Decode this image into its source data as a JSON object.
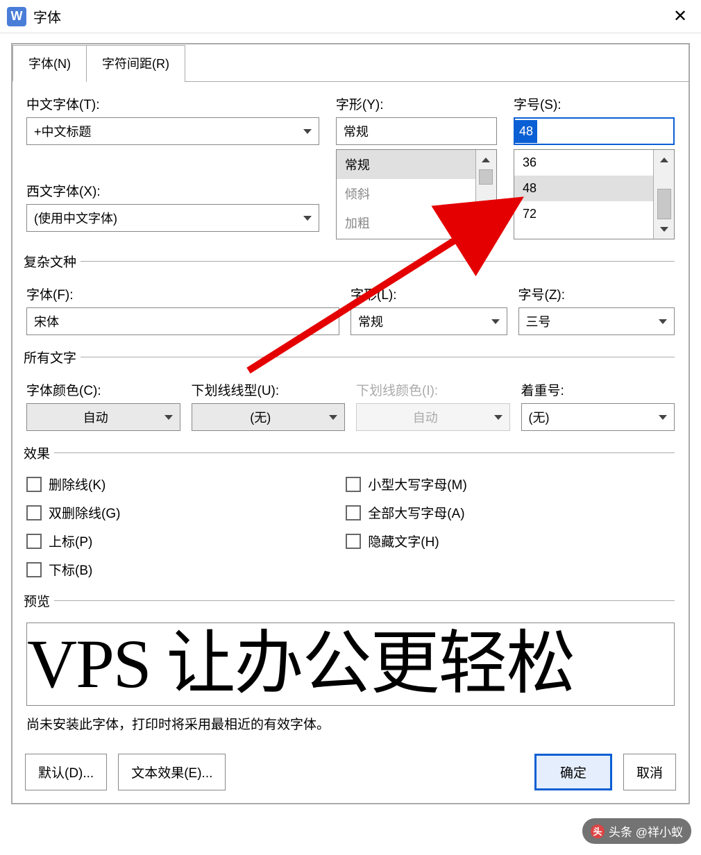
{
  "titlebar": {
    "app_initial": "W",
    "title": "字体"
  },
  "tabs": {
    "font": "字体(N)",
    "spacing": "字符间距(R)"
  },
  "section_font": {
    "cn_font_label": "中文字体(T):",
    "cn_font_value": "+中文标题",
    "style_label": "字形(Y):",
    "style_value": "常规",
    "style_options": [
      "常规",
      "倾斜",
      "加粗"
    ],
    "size_label": "字号(S):",
    "size_value": "48",
    "size_options": [
      "36",
      "48",
      "72"
    ],
    "west_font_label": "西文字体(X):",
    "west_font_value": "(使用中文字体)"
  },
  "section_complex": {
    "legend": "复杂文种",
    "font_label": "字体(F):",
    "font_value": "宋体",
    "style_label": "字形(L):",
    "style_value": "常规",
    "size_label": "字号(Z):",
    "size_value": "三号"
  },
  "section_alltext": {
    "legend": "所有文字",
    "color_label": "字体颜色(C):",
    "color_value": "自动",
    "underline_label": "下划线线型(U):",
    "underline_value": "(无)",
    "underline_color_label": "下划线颜色(I):",
    "underline_color_value": "自动",
    "emphasis_label": "着重号:",
    "emphasis_value": "(无)"
  },
  "section_effects": {
    "legend": "效果",
    "strike": "删除线(K)",
    "double_strike": "双删除线(G)",
    "superscript": "上标(P)",
    "subscript": "下标(B)",
    "smallcaps": "小型大写字母(M)",
    "allcaps": "全部大写字母(A)",
    "hidden": "隐藏文字(H)"
  },
  "section_preview": {
    "legend": "预览",
    "text": "VPS 让办公更轻松",
    "note": "尚未安装此字体，打印时将采用最相近的有效字体。"
  },
  "buttons": {
    "default": "默认(D)...",
    "text_effects": "文本效果(E)...",
    "ok": "确定",
    "cancel": "取消"
  },
  "watermark": "头条 @祥小蚁"
}
